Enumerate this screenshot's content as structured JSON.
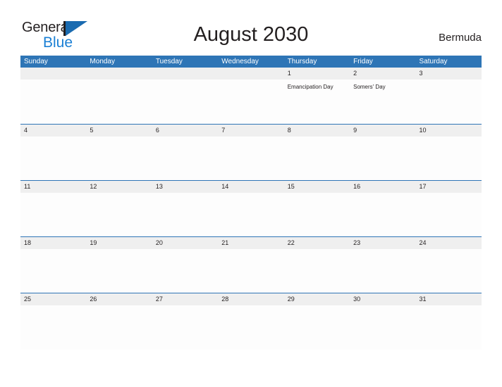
{
  "brand": {
    "name_part1": "General",
    "name_part2": "Blue",
    "flag_icon": "flag-triangle-icon",
    "color_dark": "#231f20",
    "color_blue": "#1a7fd4",
    "color_flag": "#1a6bb0"
  },
  "header": {
    "title": "August 2030",
    "locale": "Bermuda"
  },
  "theme": {
    "header_blue": "#2e75b6",
    "band_gray": "#efefef",
    "text": "#231f20",
    "page_bg": "#ffffff"
  },
  "calendar": {
    "weekdays": [
      "Sunday",
      "Monday",
      "Tuesday",
      "Wednesday",
      "Thursday",
      "Friday",
      "Saturday"
    ],
    "weeks": [
      {
        "days": [
          {
            "num": "",
            "events": []
          },
          {
            "num": "",
            "events": []
          },
          {
            "num": "",
            "events": []
          },
          {
            "num": "",
            "events": []
          },
          {
            "num": "1",
            "events": [
              "Emancipation Day"
            ]
          },
          {
            "num": "2",
            "events": [
              "Somers' Day"
            ]
          },
          {
            "num": "3",
            "events": []
          }
        ]
      },
      {
        "days": [
          {
            "num": "4",
            "events": []
          },
          {
            "num": "5",
            "events": []
          },
          {
            "num": "6",
            "events": []
          },
          {
            "num": "7",
            "events": []
          },
          {
            "num": "8",
            "events": []
          },
          {
            "num": "9",
            "events": []
          },
          {
            "num": "10",
            "events": []
          }
        ]
      },
      {
        "days": [
          {
            "num": "11",
            "events": []
          },
          {
            "num": "12",
            "events": []
          },
          {
            "num": "13",
            "events": []
          },
          {
            "num": "14",
            "events": []
          },
          {
            "num": "15",
            "events": []
          },
          {
            "num": "16",
            "events": []
          },
          {
            "num": "17",
            "events": []
          }
        ]
      },
      {
        "days": [
          {
            "num": "18",
            "events": []
          },
          {
            "num": "19",
            "events": []
          },
          {
            "num": "20",
            "events": []
          },
          {
            "num": "21",
            "events": []
          },
          {
            "num": "22",
            "events": []
          },
          {
            "num": "23",
            "events": []
          },
          {
            "num": "24",
            "events": []
          }
        ]
      },
      {
        "days": [
          {
            "num": "25",
            "events": []
          },
          {
            "num": "26",
            "events": []
          },
          {
            "num": "27",
            "events": []
          },
          {
            "num": "28",
            "events": []
          },
          {
            "num": "29",
            "events": []
          },
          {
            "num": "30",
            "events": []
          },
          {
            "num": "31",
            "events": []
          }
        ]
      }
    ]
  }
}
